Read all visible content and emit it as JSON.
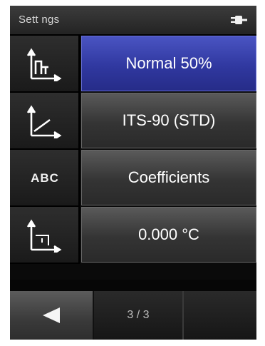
{
  "window": {
    "title": "Sett ngs"
  },
  "rows": [
    {
      "icon": "step-profile-icon",
      "value": "Normal 50%",
      "active": true
    },
    {
      "icon": "curve-icon",
      "value": "ITS-90 (STD)",
      "active": false
    },
    {
      "icon_text": "ABC",
      "value": "Coefficients",
      "active": false
    },
    {
      "icon": "offset-icon",
      "value": "0.000 °C",
      "active": false
    }
  ],
  "footer": {
    "back_icon": "left-arrow-icon",
    "page": "3 / 3"
  },
  "colors": {
    "accent": "#3038a0",
    "button": "#3a3a3a",
    "background": "#0a0a0a"
  }
}
